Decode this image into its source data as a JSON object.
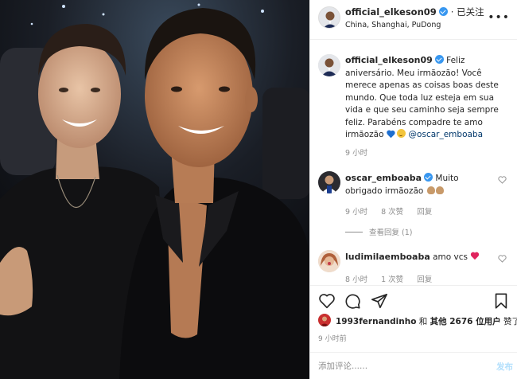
{
  "header": {
    "username": "official_elkeson09",
    "follow_status": "· 已关注",
    "location": "China, Shanghai, PuDong",
    "more": "•••"
  },
  "caption": {
    "username": "official_elkeson09",
    "text": "Feliz aniversário. Meu irmãozão! Você merece apenas as coisas boas deste mundo. Que toda luz esteja em sua vida e que seu caminho seja sempre feliz. Parabéns compadre te amo irmãozão",
    "mention": "@oscar_emboaba",
    "time": "9 小时"
  },
  "comments": [
    {
      "username": "oscar_emboaba",
      "text": "Muito obrigado irmãozão",
      "time": "9 小时",
      "likes": "8 次赞",
      "reply": "回复"
    },
    {
      "username": "ludimilaemboaba",
      "text": "amo vcs",
      "time": "8 小时",
      "likes": "1 次赞",
      "reply": "回复"
    }
  ],
  "view_replies": "查看回复 (1)",
  "likes": {
    "username": "1993fernandinho",
    "joiner": "和",
    "others": "其他 2676 位用户",
    "suffix": "赞了"
  },
  "post_time": "9 小时前",
  "add_comment": {
    "placeholder": "添加评论......",
    "post_label": "发布"
  },
  "colors": {
    "verified": "#3897f0",
    "link": "#00376b",
    "muted": "#8e8e8e",
    "post_button": "#b2dffc"
  }
}
